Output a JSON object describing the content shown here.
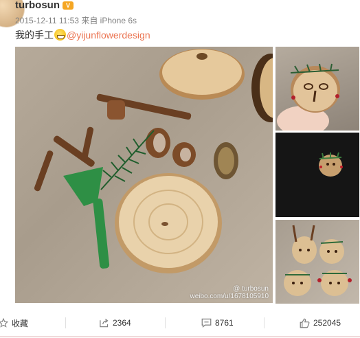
{
  "post": {
    "username": "turbosun",
    "timestamp": "2015-12-11 11:53",
    "source": "来自 iPhone 6s",
    "text_before": "我的手工",
    "mention": "@yijunflowerdesign"
  },
  "images": {
    "watermark_line1": "@ turbosun",
    "watermark_line2": "weibo.com/u/1678105910"
  },
  "actions": {
    "favorite_label": "收藏",
    "repost_count": "2364",
    "comment_count": "8761",
    "like_count": "252045"
  },
  "icons": {
    "vip": "vip-badge-icon",
    "emoji": "grin-emoji-icon",
    "favorite": "star-icon",
    "repost": "share-icon",
    "comment": "comment-icon",
    "like": "thumbs-up-icon"
  },
  "colors": {
    "mention": "#eb7350",
    "meta": "#808080",
    "text": "#333333"
  }
}
